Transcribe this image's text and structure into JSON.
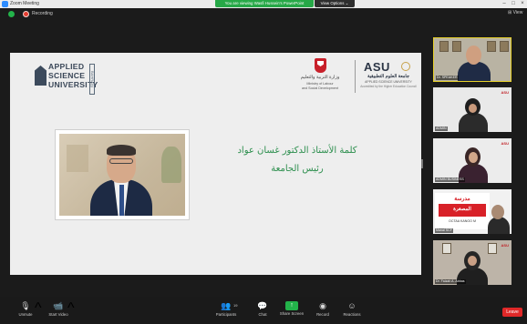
{
  "window": {
    "title": "Zoom Meeting",
    "share_banner": "You are viewing Wasfi Hussein's PowerPoint",
    "view_options": "View Options ⌄",
    "controls": [
      "–",
      "□",
      "×"
    ]
  },
  "meeting": {
    "recording_label": "Recording",
    "view_label": "⊞ View"
  },
  "slide": {
    "left_logo": {
      "lines": [
        "APPLIED",
        "SCIENCE",
        "UNIVERSITY"
      ],
      "vertical": "BAHRAIN"
    },
    "ministry": {
      "arabic": "وزارة التربية والتعليم",
      "english_1": "Ministry of Labour",
      "english_2": "and Social Development"
    },
    "asu": {
      "wordmark": "ASU",
      "arabic": "جامعة العلوم التطبيقية",
      "english": "APPLIED SCIENCE UNIVERSITY",
      "accreditation": "Accredited by the Higher Education Council"
    },
    "speech_title": "كلمة الأستاذ الدكتور غسان عواد",
    "speech_subtitle": "رئيس الجامعة"
  },
  "participants": [
    {
      "name": "Dr. SPEAKER",
      "highlight": true
    },
    {
      "name": "ADMIN",
      "logo": "ASU"
    },
    {
      "name": "ADMIN BUSINESS",
      "logo": "ASU"
    },
    {
      "name": "Manal SCF",
      "slide_title": "مدرسة",
      "slide_word": "المصغرة",
      "slide_en": "OCTAA KANOO M"
    },
    {
      "name": "Dr. Faizah A. Abbas",
      "logo": "ASU"
    }
  ],
  "toolbar": {
    "unmute": "Unmute",
    "start_video": "Start Video",
    "participants": "Participants",
    "participants_count": "19",
    "chat": "Chat",
    "share_screen": "Share Screen",
    "record": "Record",
    "reactions": "Reactions",
    "leave": "Leave"
  }
}
